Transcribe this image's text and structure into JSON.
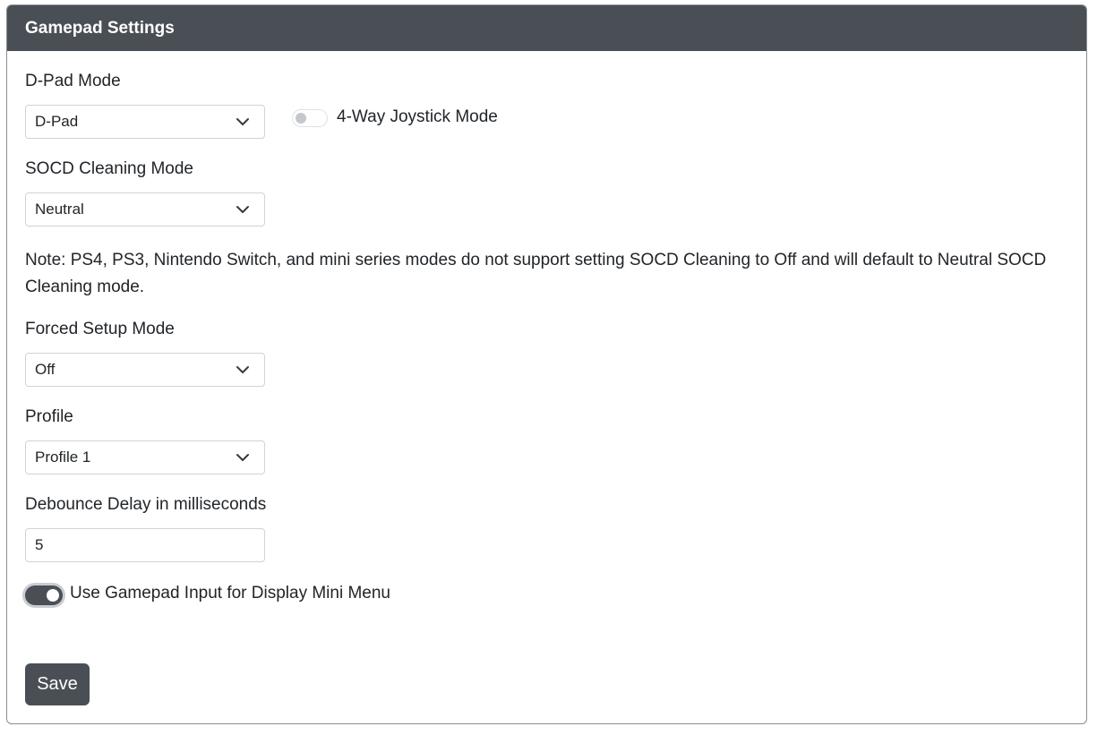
{
  "card": {
    "title": "Gamepad Settings"
  },
  "dpad": {
    "label": "D-Pad Mode",
    "selected": "D-Pad",
    "joystick_toggle_label": "4-Way Joystick Mode",
    "joystick_toggle_on": false
  },
  "socd": {
    "label": "SOCD Cleaning Mode",
    "selected": "Neutral",
    "note": "Note: PS4, PS3, Nintendo Switch, and mini series modes do not support setting SOCD Cleaning to Off and will default to Neutral SOCD Cleaning mode."
  },
  "forced_setup": {
    "label": "Forced Setup Mode",
    "selected": "Off"
  },
  "profile": {
    "label": "Profile",
    "selected": "Profile 1"
  },
  "debounce": {
    "label": "Debounce Delay in milliseconds",
    "value": "5"
  },
  "mini_menu": {
    "label": "Use Gamepad Input for Display Mini Menu",
    "toggle_on": true
  },
  "actions": {
    "save_label": "Save"
  },
  "icons": {
    "dropdown": "chevron-down-icon"
  },
  "colors": {
    "header_bg": "#4a4f55",
    "button_bg": "#4a4f55",
    "border": "#ced4da"
  }
}
